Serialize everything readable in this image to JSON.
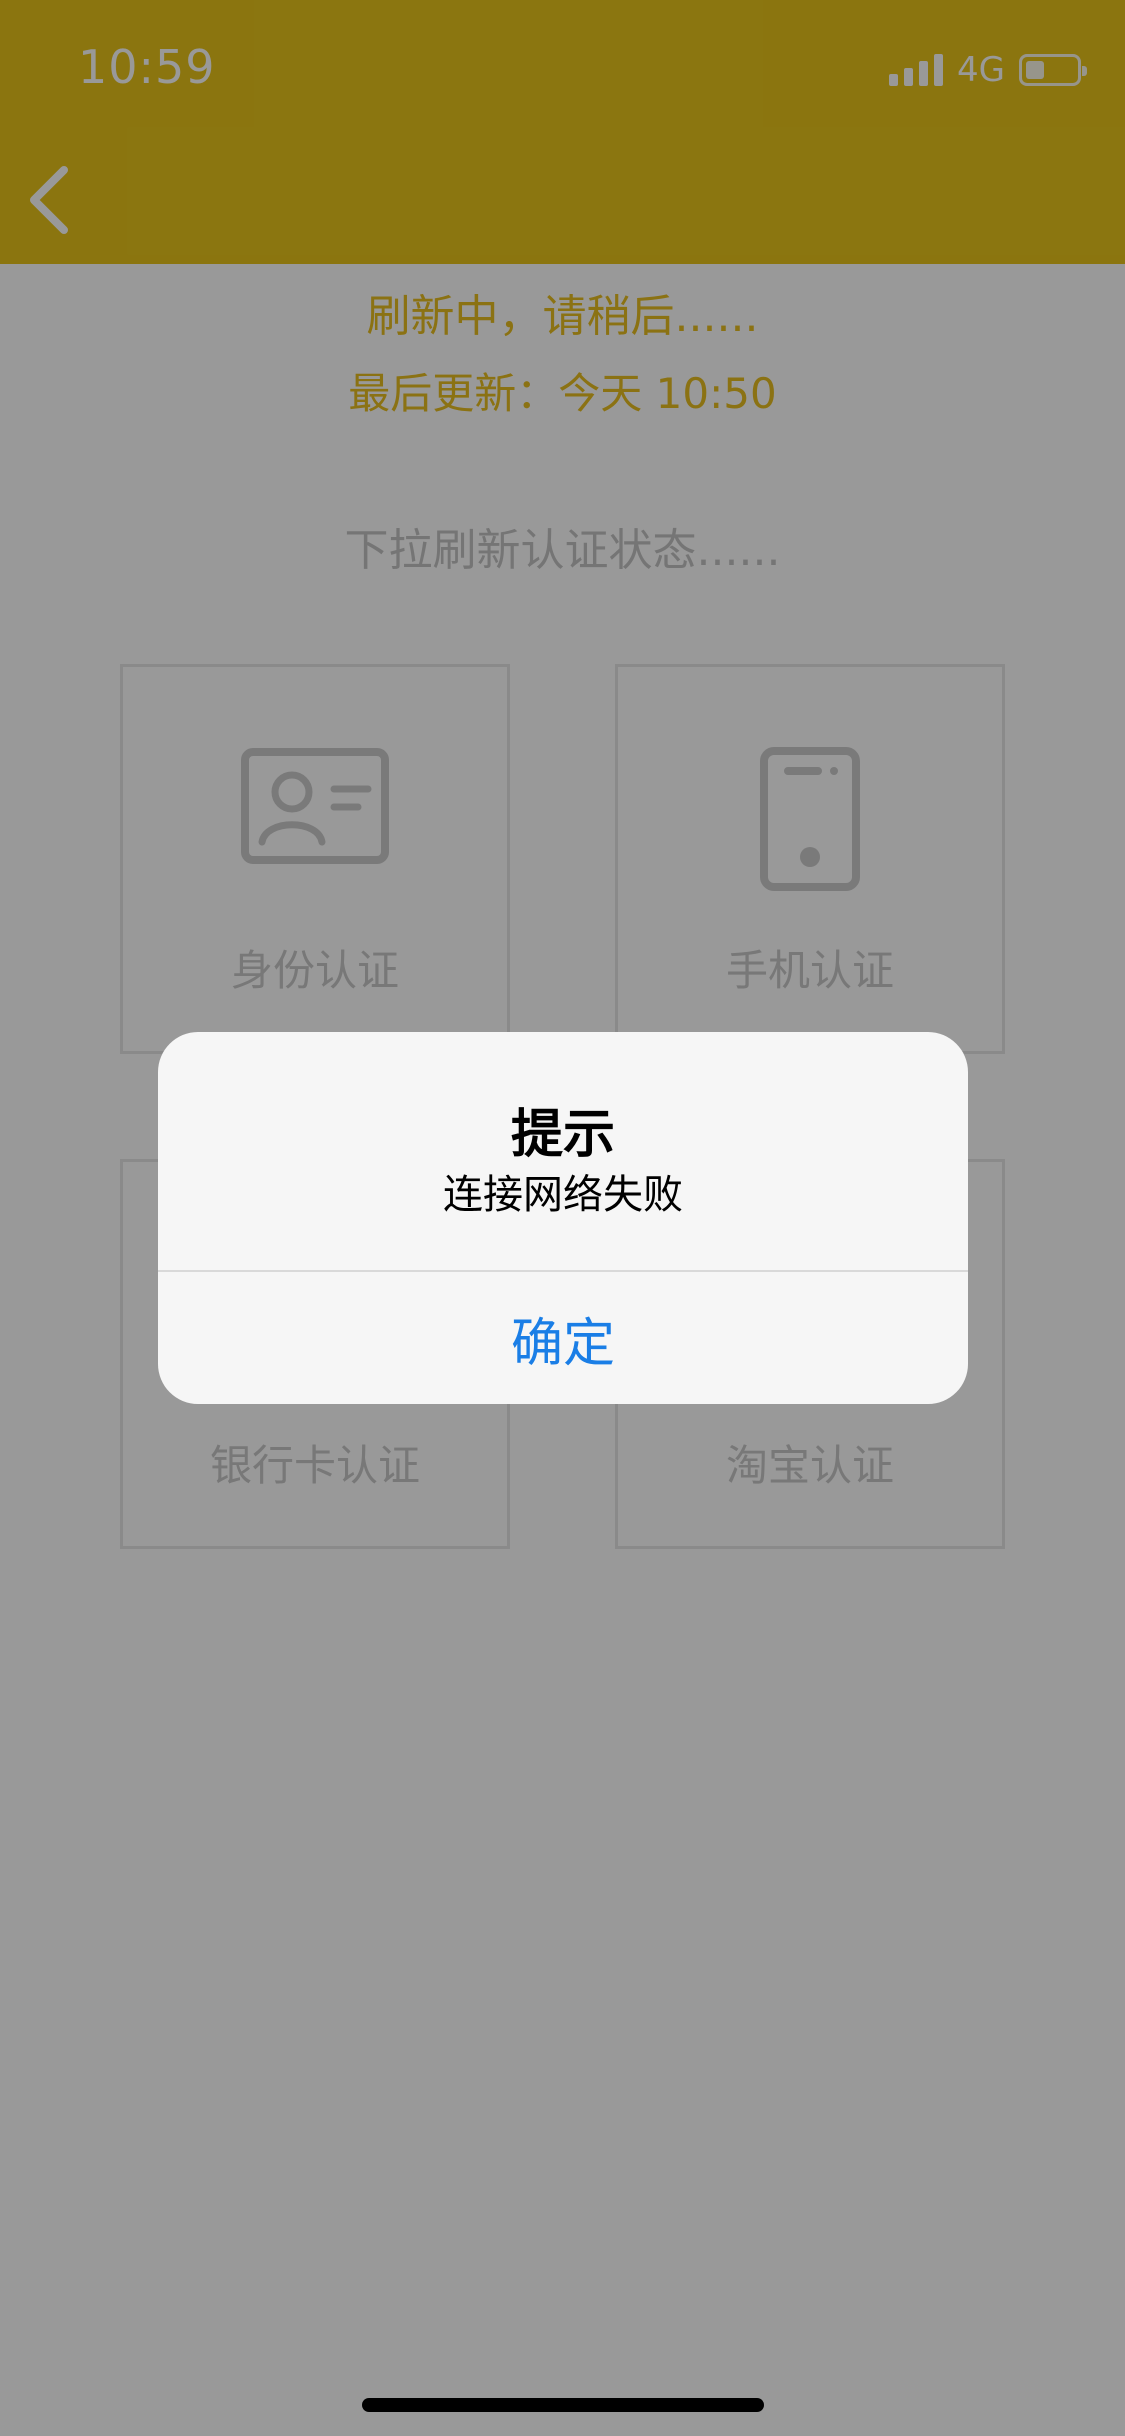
{
  "status_bar": {
    "time": "10:59",
    "network": "4G",
    "battery_level": 0.35
  },
  "nav": {
    "back_icon": "chevron-left-icon",
    "color": "#E8C41A"
  },
  "refresh": {
    "title": "刷新中，请稍后......",
    "last_update": "最后更新：今天 10:50",
    "color": "#E8BE20"
  },
  "hint": "下拉刷新认证状态......",
  "cards": {
    "id": {
      "label": "身份认证",
      "icon": "id-card-icon"
    },
    "phone": {
      "label": "手机认证",
      "icon": "phone-icon"
    },
    "bank": {
      "label": "银行卡认证",
      "icon": "bank-card-icon"
    },
    "taobao": {
      "label": "淘宝认证",
      "icon": "taobao-icon"
    }
  },
  "alert": {
    "title": "提示",
    "message": "连接网络失败",
    "button": "确定",
    "button_color": "#1a7ee6"
  }
}
